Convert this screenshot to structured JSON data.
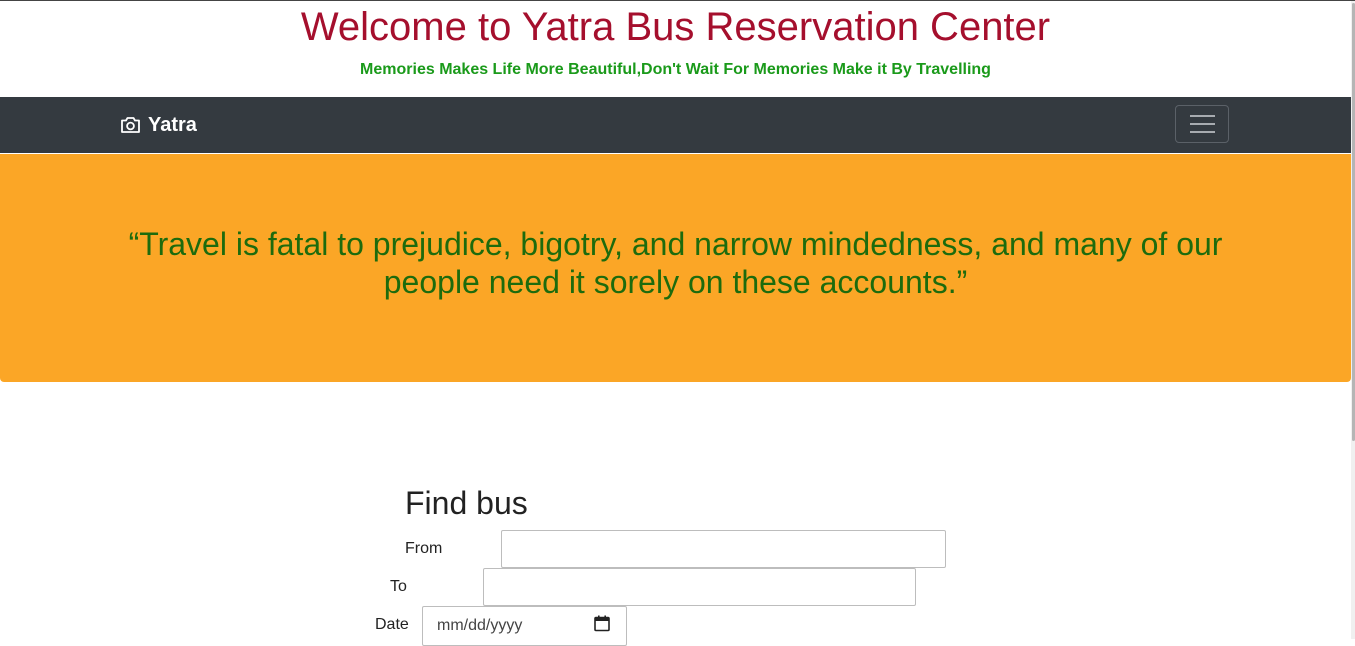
{
  "header": {
    "title": "Welcome to Yatra Bus Reservation Center",
    "tagline": "Memories Makes Life More Beautiful,Don't Wait For Memories Make it By Travelling"
  },
  "navbar": {
    "brand": "Yatra",
    "brand_icon": "camera-icon",
    "toggler_icon": "hamburger-menu-icon"
  },
  "hero": {
    "quote": "“Travel is fatal to prejudice, bigotry, and narrow mindedness, and many of our people need it sorely on these accounts.”"
  },
  "find_bus": {
    "title": "Find bus",
    "from_label": "From",
    "from_value": "",
    "to_label": "To",
    "to_value": "",
    "date_label": "Date",
    "date_placeholder": "mm/dd/yyyy"
  },
  "colors": {
    "title": "#a50f2d",
    "tagline": "#1a9a1a",
    "navbar": "#343a40",
    "hero": "#fba626",
    "quote": "#1d6b0d"
  }
}
